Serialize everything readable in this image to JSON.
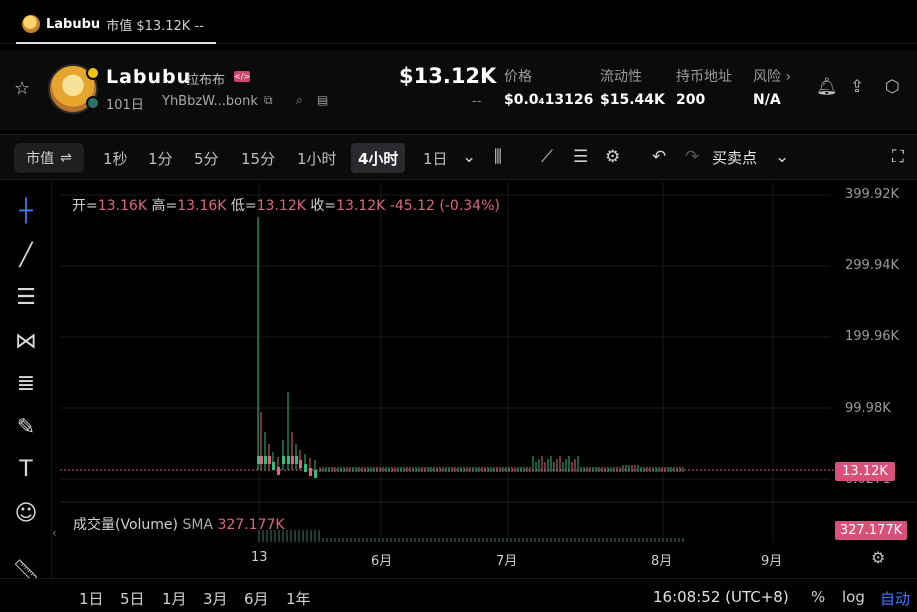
{
  "tab": {
    "name": "Labubu",
    "subtitle": "市值 $13.12K --"
  },
  "token": {
    "name": "Labubu",
    "name_cn": "拉布布",
    "age": "101日",
    "address": "YhBbzW...bonk",
    "market_cap": "$13.12K",
    "market_cap_change": "--"
  },
  "stats": [
    {
      "label": "价格",
      "value": "$0.0₄13126"
    },
    {
      "label": "流动性",
      "value": "$15.44K"
    },
    {
      "label": "持币地址",
      "value": "200"
    },
    {
      "label": "风险",
      "value": "N/A"
    }
  ],
  "toolbar": {
    "metric": "市值",
    "intervals": [
      "1秒",
      "1分",
      "5分",
      "15分",
      "1小时",
      "4小时",
      "1日"
    ],
    "active_interval": "4小时",
    "trades_label": "买卖点"
  },
  "ohlc": {
    "open_label": "开=",
    "open": "13.16K",
    "high_label": "高=",
    "high": "13.16K",
    "low_label": "低=",
    "low": "13.12K",
    "close_label": "收=",
    "close": "13.12K",
    "change": "-45.12 (-0.34%)"
  },
  "y_axis": [
    "399.92K",
    "299.94K",
    "199.96K",
    "99.98K",
    "0.0271"
  ],
  "price_tag": "13.12K",
  "volume": {
    "label": "成交量(Volume)",
    "sma": "SMA",
    "sma_value": "327.177K",
    "tag": "327.177K"
  },
  "x_axis": [
    "13",
    "6月",
    "7月",
    "8月",
    "9月"
  ],
  "ranges": [
    "1日",
    "5日",
    "1月",
    "3月",
    "6月",
    "1年"
  ],
  "clock": "16:08:52 (UTC+8)",
  "options": [
    "%",
    "log",
    "自动"
  ],
  "colors": {
    "up": "#2ebd85",
    "down": "#e0667f",
    "accent": "#3f7cff"
  },
  "chart_data": {
    "type": "line",
    "x": [
      "13",
      "6月",
      "7月",
      "8月"
    ],
    "series": [
      {
        "values": [
          13.12,
          13.12,
          13.12,
          13.12
        ]
      }
    ],
    "ylabel": "",
    "ylim": [
      0,
      399.92
    ]
  }
}
